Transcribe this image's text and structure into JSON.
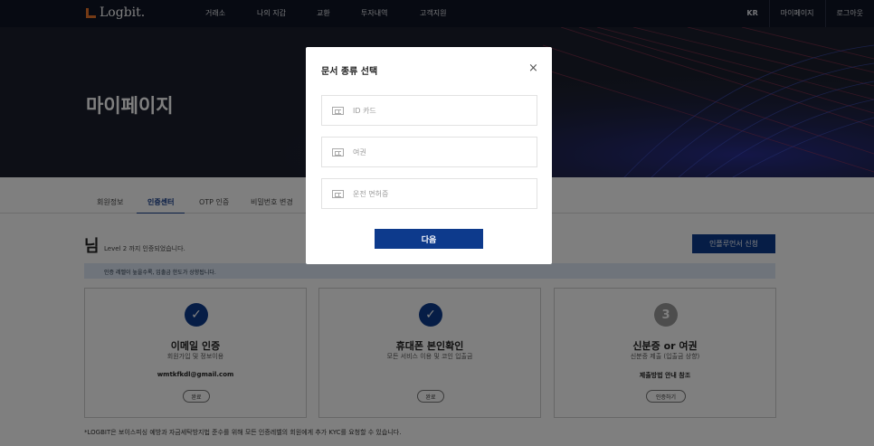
{
  "header": {
    "logo": "Logbit.",
    "nav": [
      "거래소",
      "나의 지갑",
      "교환",
      "투자내역",
      "고객지원"
    ],
    "lang": "KR",
    "mypage": "마이페이지",
    "logout": "로그아웃"
  },
  "hero": {
    "title": "마이페이지"
  },
  "tabs": [
    "회원정보",
    "인증센터",
    "OTP 인증",
    "비밀번호 변경"
  ],
  "verify": {
    "greeting": "님",
    "level_text": "Level 2 까지 인증되었습니다.",
    "apply_label": "인플루언서 신청",
    "notice": "인증 레벨이 높을수록, 입출금 한도가 상향됩니다."
  },
  "cards": [
    {
      "title": "이메일 인증",
      "sub": "회원가입 및 정보이용",
      "extra": "wmtkfkdl@gmail.com",
      "button": "완료",
      "icon": "check-icon"
    },
    {
      "title": "휴대폰 본인확인",
      "sub": "모든 서비스 이용 및 코인 입출금",
      "extra": "",
      "button": "완료",
      "icon": "check-icon"
    },
    {
      "title": "신분증 or 여권",
      "sub": "신분증 제출 (입출금 상향)",
      "extra": "제출방법 안내 참조",
      "button": "인증하기",
      "step": "3"
    }
  ],
  "footnote": "*LOGBIT은 보이스피싱 예방과 자금세탁방지법 준수를 위해 모든 인증레벨의 회원에게 추가 KYC를 요청할 수 있습니다.",
  "modal": {
    "title": "문서 종류 선택",
    "close": "×",
    "options": [
      "ID 카드",
      "여권",
      "운전 면허증"
    ],
    "next": "다음"
  },
  "colors": {
    "brand": "#0d3a8c",
    "logo_accent": "#e8742a",
    "header_bg": "#0e1424"
  }
}
